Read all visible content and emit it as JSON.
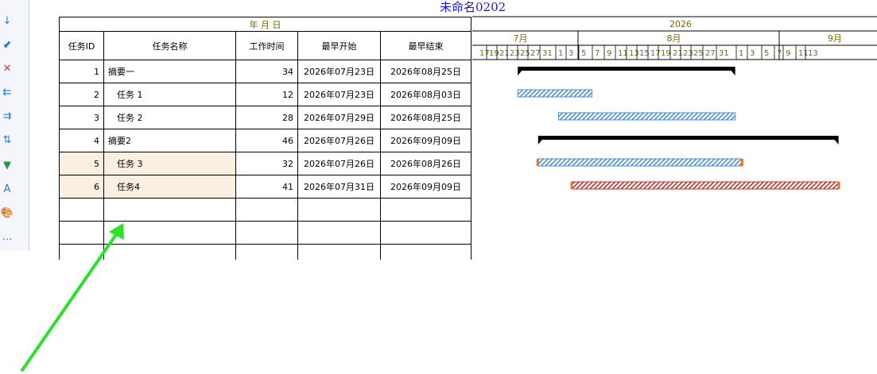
{
  "title": "未命名0202",
  "toolbar_tools": [
    {
      "name": "down-arrow-icon",
      "glyph": "↓",
      "color": "#2a7bd8"
    },
    {
      "name": "down-left-arrow-icon",
      "glyph": "⬋",
      "color": "#2a7bd8"
    },
    {
      "name": "delete-icon",
      "glyph": "✕",
      "color": "#e03a3a"
    },
    {
      "name": "outdent-icon",
      "glyph": "⇇",
      "color": "#2a7bd8"
    },
    {
      "name": "indent-icon",
      "glyph": "⇉",
      "color": "#2a7bd8"
    },
    {
      "name": "sort-icon",
      "glyph": "⇅",
      "color": "#2a7bd8"
    },
    {
      "name": "filter-icon",
      "glyph": "▼",
      "color": "#1a9a3a"
    },
    {
      "name": "font-icon",
      "glyph": "A",
      "color": "#2a7bd8"
    },
    {
      "name": "palette-icon",
      "glyph": "🎨",
      "color": "#c0392b"
    },
    {
      "name": "more-icon",
      "glyph": "…",
      "color": "#2a7bd8"
    }
  ],
  "table": {
    "date_format_label": "年 月 日",
    "columns": [
      "任务ID",
      "任务名称",
      "工作时间",
      "最早开始",
      "最早结束"
    ],
    "rows": [
      {
        "id": "1",
        "name": "摘要一",
        "work": "34",
        "start": "2026年07月23日",
        "end": "2026年08月25日",
        "indent": false,
        "highlight": false
      },
      {
        "id": "2",
        "name": "任务 1",
        "work": "12",
        "start": "2026年07月23日",
        "end": "2026年08月03日",
        "indent": true,
        "highlight": false
      },
      {
        "id": "3",
        "name": "任务 2",
        "work": "28",
        "start": "2026年07月29日",
        "end": "2026年08月25日",
        "indent": true,
        "highlight": false
      },
      {
        "id": "4",
        "name": "摘要2",
        "work": "46",
        "start": "2026年07月26日",
        "end": "2026年09月09日",
        "indent": false,
        "highlight": false
      },
      {
        "id": "5",
        "name": "任务 3",
        "work": "32",
        "start": "2026年07月26日",
        "end": "2026年08月26日",
        "indent": true,
        "highlight": true
      },
      {
        "id": "6",
        "name": "任务4",
        "work": "41",
        "start": "2026年07月31日",
        "end": "2026年09月09日",
        "indent": true,
        "highlight": true
      },
      {
        "id": "",
        "name": "",
        "work": "",
        "start": "",
        "end": "",
        "indent": false,
        "highlight": false
      },
      {
        "id": "",
        "name": "",
        "work": "",
        "start": "",
        "end": "",
        "indent": false,
        "highlight": false
      },
      {
        "id": "",
        "name": "",
        "work": "",
        "start": "",
        "end": "",
        "indent": false,
        "highlight": false
      }
    ]
  },
  "gantt": {
    "year": "2026",
    "months": [
      "7月",
      "8月",
      "9月"
    ],
    "days": [
      "17",
      "19",
      "21",
      "23",
      "25",
      "27",
      "31",
      "1",
      "3",
      "5",
      "7",
      "9",
      "11",
      "13",
      "15",
      "17",
      "19",
      "21",
      "23",
      "25",
      "27",
      "31",
      "1",
      "3",
      "5",
      "7",
      "9",
      "11",
      "13"
    ],
    "header_color": "#7a6a00",
    "bars": [
      {
        "row": 0,
        "type": "summary",
        "start": "2026-07-23",
        "end": "2026-08-25"
      },
      {
        "row": 1,
        "type": "task",
        "start": "2026-07-23",
        "end": "2026-08-03"
      },
      {
        "row": 2,
        "type": "task",
        "start": "2026-07-29",
        "end": "2026-08-25"
      },
      {
        "row": 3,
        "type": "summary",
        "start": "2026-07-26",
        "end": "2026-09-09"
      },
      {
        "row": 4,
        "type": "task",
        "start": "2026-07-26",
        "end": "2026-08-26"
      },
      {
        "row": 5,
        "type": "critical",
        "start": "2026-07-31",
        "end": "2026-09-09"
      }
    ],
    "colors": {
      "task": "#4a8fd0",
      "critical": "#c0302a",
      "summary": "#000000",
      "handle": "#e07a20"
    }
  },
  "annotation": {
    "color": "#29e22a"
  }
}
